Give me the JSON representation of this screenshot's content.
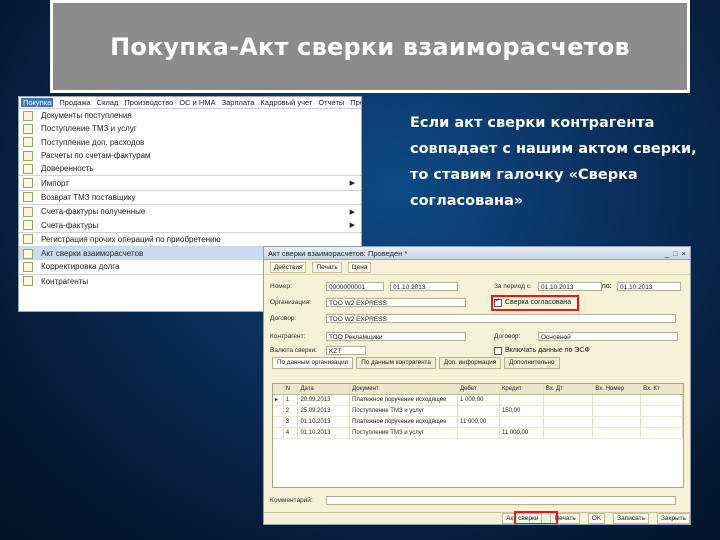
{
  "slide": {
    "title": "Покупка-Акт сверки взаиморасчетов",
    "note": "Если акт сверки контрагента совпадает с нашим актом сверки, то ставим галочку «Сверка согласована»"
  },
  "menu": {
    "bar": [
      "Покупка",
      "Продажа",
      "Склад",
      "Производство",
      "ОС и НМА",
      "Зарплата",
      "Кадровый учет",
      "Отчеты",
      "Предприятие"
    ],
    "items": [
      {
        "label": "Документы поступления",
        "submenu": false
      },
      {
        "label": "Поступление ТМЗ и услуг",
        "submenu": false
      },
      {
        "label": "Поступление доп. расходов",
        "submenu": false
      },
      {
        "label": "Расчеты по счетам-фактурам",
        "submenu": false
      },
      {
        "label": "Доверенность",
        "submenu": false
      },
      {
        "label": "Импорт",
        "submenu": true
      },
      {
        "label": "Возврат ТМЗ поставщику",
        "submenu": false
      },
      {
        "label": "Счета-фактуры полученные",
        "submenu": true
      },
      {
        "label": "Счета-фактуры",
        "submenu": true
      },
      {
        "label": "Регистрация прочих операций по приобретению",
        "submenu": false
      },
      {
        "label": "Акт сверки взаиморасчетов",
        "submenu": false
      },
      {
        "label": "Корректировка долга",
        "submenu": false
      },
      {
        "label": "Контрагенты",
        "submenu": false
      }
    ]
  },
  "doc": {
    "window_title": "Акт сверки взаиморасчетов: Проведен *",
    "toolbar": [
      "Действия",
      "Печать",
      "Цена"
    ],
    "labels": {
      "number": "Номер:",
      "org": "Организация:",
      "contract": "Договор:",
      "counterparty": "Контрагент:",
      "currency": "Валюта сверки:",
      "period": "За период с:",
      "to": "по:",
      "agreed": "Сверка согласована",
      "include": "Включать данные по ЭСФ"
    },
    "values": {
      "number": "0000000001",
      "date": "01.10.2013",
      "date_to": "01.10.2013",
      "org": "ТОО W2 EXPRESS",
      "contract": "ТОО W2 EXPRESS",
      "counterparty": "ТОО Рекламщики",
      "currency": "KZT",
      "dogovor": "Основной"
    },
    "tabs": [
      "По данным организации",
      "По данным контрагента",
      "Доп. информация",
      "Дополнительно"
    ],
    "columns": [
      "N",
      "Дата",
      "Документ",
      "Дебет",
      "Кредит",
      "Вх. Дт",
      "Вх. Номер",
      "Вх. Кт"
    ],
    "rows": [
      [
        "1",
        "20.09.2013",
        "Платежное поручение исходящее",
        "1 000,00",
        "",
        "",
        "",
        ""
      ],
      [
        "2",
        "25.09.2013",
        "Поступление ТМЗ и услуг",
        "",
        "150,00",
        "",
        "",
        ""
      ],
      [
        "3",
        "01.10.2013",
        "Платежное поручение исходящее",
        "11 000,00",
        "",
        "",
        "",
        ""
      ],
      [
        "4",
        "01.10.2013",
        "Поступление ТМЗ и услуг",
        "",
        "11 000,00",
        "",
        "",
        ""
      ]
    ],
    "comment_label": "Комментарий:",
    "footer": [
      "Акт сверки",
      "Печать",
      "OK",
      "Записать",
      "Закрыть"
    ]
  }
}
